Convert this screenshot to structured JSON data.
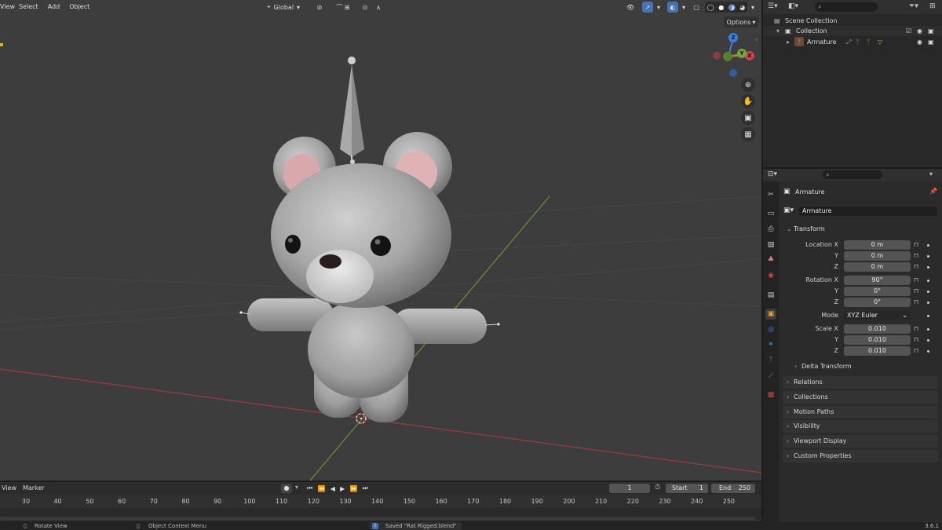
{
  "viewport": {
    "menus": [
      "View",
      "Select",
      "Add",
      "Object"
    ],
    "orientation": "Global",
    "options_label": "Options",
    "gizmo_axes": [
      "X",
      "Y",
      "Z"
    ]
  },
  "outliner": {
    "rows": [
      {
        "label": "Scene Collection"
      },
      {
        "label": "Collection"
      },
      {
        "label": "Armature"
      }
    ]
  },
  "properties": {
    "object_name": "Armature",
    "data_name": "Armature",
    "transform_title": "Transform",
    "location": {
      "label": "Location X",
      "x": "0 m",
      "y": "0 m",
      "z": "0 m"
    },
    "rotation": {
      "label": "Rotation X",
      "x": "90°",
      "y": "0°",
      "z": "0°"
    },
    "mode": {
      "label": "Mode",
      "value": "XYZ Euler"
    },
    "scale": {
      "label": "Scale X",
      "x": "0.010",
      "y": "0.010",
      "z": "0.010"
    },
    "axis_y": "Y",
    "axis_z": "Z",
    "delta_transform": "Delta Transform",
    "panels": [
      "Relations",
      "Collections",
      "Motion Paths",
      "Visibility",
      "Viewport Display",
      "Custom Properties"
    ]
  },
  "timeline": {
    "menus": [
      "View",
      "Marker"
    ],
    "current_frame": "1",
    "start_label": "Start",
    "start_value": "1",
    "end_label": "End",
    "end_value": "250",
    "ticks": [
      "30",
      "40",
      "50",
      "60",
      "70",
      "80",
      "90",
      "100",
      "110",
      "120",
      "130",
      "140",
      "150",
      "160",
      "170",
      "180",
      "190",
      "200",
      "210",
      "220",
      "230",
      "240",
      "250"
    ]
  },
  "statusbar": {
    "left_hint": "Rotate View",
    "middle_hint": "Object Context Menu",
    "message": "Saved \"Rat Rigged.blend\"",
    "version": "3.6.1"
  },
  "colors": {
    "accent": "#4772b3",
    "x_axis": "#c8464a",
    "y_axis": "#7aa23a",
    "z_axis": "#3d7fd6"
  }
}
